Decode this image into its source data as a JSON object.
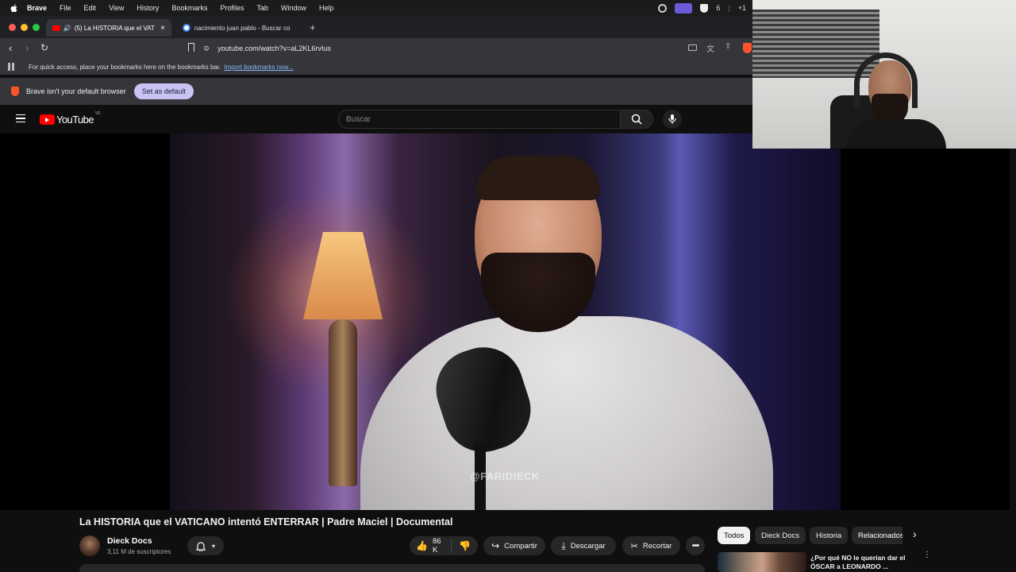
{
  "menubar": {
    "app": "Brave",
    "items": [
      "File",
      "Edit",
      "View",
      "History",
      "Bookmarks",
      "Profiles",
      "Tab",
      "Window",
      "Help"
    ],
    "status_count": "6",
    "status_extra": "+1"
  },
  "tabs": [
    {
      "label": "(5) La HISTORIA que el VAT",
      "active": true
    },
    {
      "label": "nacimiento juan pablo - Buscar co",
      "active": false
    }
  ],
  "toolbar": {
    "url": "youtube.com/watch?v=aL2KL6rvIus"
  },
  "bookmarks_bar": {
    "message": "For quick access, place your bookmarks here on the bookmarks bar.",
    "import_link": "Import bookmarks now..."
  },
  "infobar": {
    "message": "Brave isn't your default browser",
    "button": "Set as default"
  },
  "youtube": {
    "logo": "YouTube",
    "region": "VE",
    "search_placeholder": "Buscar"
  },
  "video": {
    "watermark": "@FARIDIECK",
    "title": "La HISTORIA que el VATICANO intentó ENTERRAR | Padre Maciel | Documental",
    "channel": "Dieck Docs",
    "subscribers": "3,11 M de suscriptores",
    "likes": "86 K",
    "share": "Compartir",
    "download": "Descargar",
    "clip": "Recortar"
  },
  "chips": [
    {
      "label": "Todos",
      "selected": true
    },
    {
      "label": "Dieck Docs",
      "selected": false
    },
    {
      "label": "Historia",
      "selected": false
    },
    {
      "label": "Relacionados",
      "selected": false
    }
  ],
  "recommended": {
    "title_line1": "¿Por qué NO le querían dar el",
    "title_line2": "ÓSCAR a LEONARDO ..."
  },
  "colors": {
    "accent_red": "#ff0000",
    "set_default_bg": "#c8c3f3",
    "link_blue": "#8ab4f8",
    "brave_orange": "#fb542b"
  }
}
